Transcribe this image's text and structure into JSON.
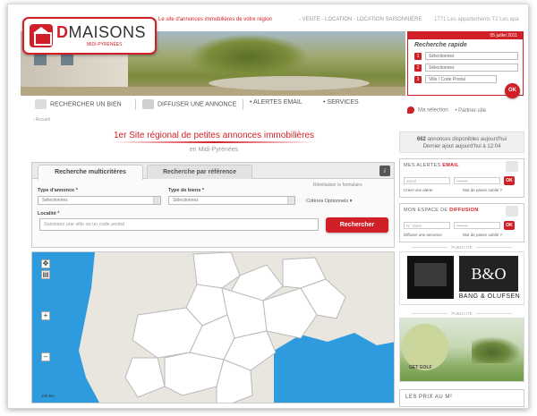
{
  "topbar": {
    "tagline": "Le site d'annonces immobilières de votre région",
    "nav": "- VENTE - LOCATION - LOCATION SAISONNIÈRE",
    "right": "1771 Les appartements T2 Les apa"
  },
  "logo": {
    "brand_d": "D",
    "brand_rest": "MAISONS",
    "region": "MIDI-PYRÉNÉES"
  },
  "quick_search": {
    "date": "05 juillet 2011",
    "title": "Recherche rapide",
    "rows": [
      {
        "num": "1",
        "value": "Sélectionnez"
      },
      {
        "num": "2",
        "value": "Sélectionnez"
      },
      {
        "num": "3",
        "value": "Ville / Code Postal"
      }
    ],
    "ok_label": "OK"
  },
  "main_nav": {
    "items": [
      "RECHERCHER UN BIEN",
      "DIFFUSER UNE ANNONCE",
      "• ALERTES EMAIL",
      "• SERVICES"
    ],
    "my_selection": "Ma sélection",
    "partner": "• Partner-site"
  },
  "breadcrumb": "› Accueil",
  "headline": {
    "highlight": "1er Site régional de petites annonces immobilières",
    "sub": "en Midi-Pyrénées"
  },
  "stats": {
    "count": "662",
    "count_text": "annonces disponibles aujourd'hui",
    "last": "Dernier ajout aujourd'hui à 12:04"
  },
  "search_panel": {
    "tabs": [
      "Recherche multicritères",
      "Recherche par référence"
    ],
    "info_icon": "i",
    "reinit": "Réinitialiser le formulaire",
    "type_annonce_label": "Type d'annonce *",
    "type_annonce_value": "Sélectionnez",
    "type_biens_label": "Type de biens *",
    "type_biens_value": "Sélectionnez",
    "criteria": "Critères Optionnels ▾",
    "locality_label": "Localité *",
    "locality_placeholder": "Saisissez une ville ou un code postal",
    "search_button": "Rechercher"
  },
  "map": {
    "zoom_in": "+",
    "zoom_out": "–",
    "scale": "100 km"
  },
  "alerts_box": {
    "title_a": "MES ALERTES",
    "title_b": "EMAIL",
    "email_placeholder": "email",
    "pass_placeholder": "••••••••",
    "ok": "OK",
    "link1": "Créer une alerte",
    "link2": "Mot de passe oublié ?"
  },
  "diffusion_box": {
    "title_a": "MON ESPACE DE",
    "title_b": "DIFFUSION",
    "id_placeholder": "N° client",
    "pass_placeholder": "••••••••",
    "ok": "OK",
    "link1": "Diffuser une annonce",
    "link2": "Mot de passe oublié ?"
  },
  "pub_label": "PUBLICITÉ",
  "ads": {
    "bo_logo": "B&O",
    "bo_name": "BANG & OLUFSEN",
    "golf_name": "GET GOLF"
  },
  "prix_box": "LES PRIX AU M²"
}
